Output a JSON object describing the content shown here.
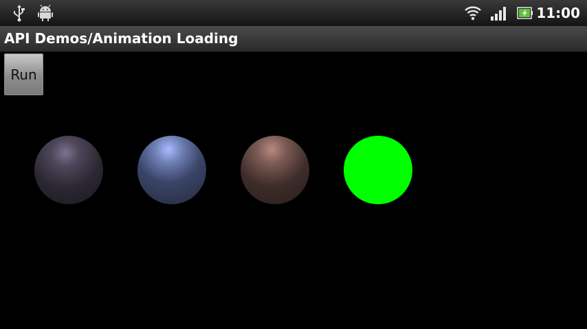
{
  "status_bar": {
    "time": "11:00",
    "icons": [
      "usb-icon",
      "android-debug-icon",
      "wifi-icon",
      "signal-icon",
      "battery-charging-icon"
    ]
  },
  "title_bar": {
    "title": "API Demos/Animation Loading"
  },
  "controls": {
    "run_label": "Run"
  },
  "balls": [
    {
      "name": "ball-purple",
      "color": "#4d4659"
    },
    {
      "name": "ball-blue",
      "color": "#6b7cb0"
    },
    {
      "name": "ball-brown",
      "color": "#7b5a54"
    },
    {
      "name": "ball-green",
      "color": "#00ff00"
    }
  ]
}
